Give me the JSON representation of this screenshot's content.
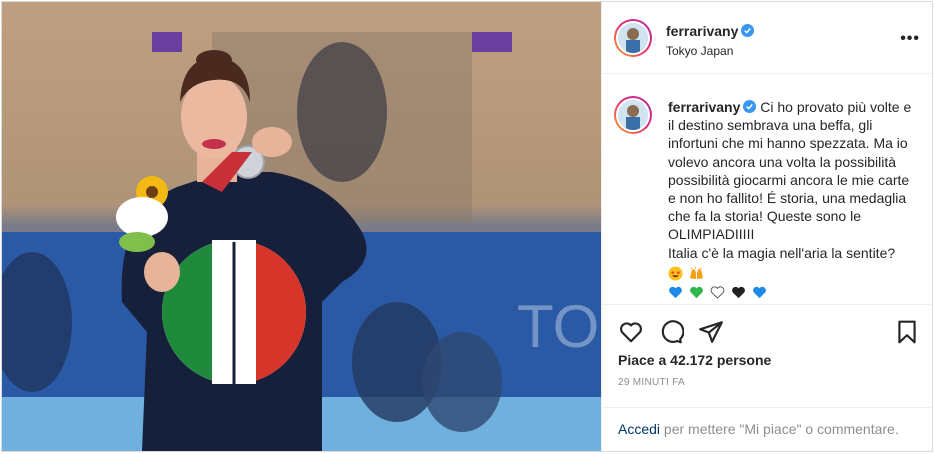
{
  "post": {
    "username": "ferrarivany",
    "location": "Tokyo Japan",
    "more_label": "•••",
    "caption_lines": [
      "Ci ho provato più volte e",
      "il destino sembrava una beffa, gli",
      "infortuni che mi hanno spezzata. Ma io",
      "volevo ancora una volta la possibilità",
      "possibilità giocarmi ancora le mie carte",
      "e non ho fallito! É storia, una medaglia",
      "che fa la storia! Queste sono le",
      "OLIMPIADIIIII",
      "Italia c'è la magia nell'aria la sentite?"
    ],
    "emojis_row1": [
      "star-struck-face",
      "raising-hands"
    ],
    "emojis_row2": [
      "blue-heart",
      "green-heart",
      "white-heart",
      "black-heart",
      "blue-heart"
    ],
    "likes": "Piace a 42.172 persone",
    "time": "29 MINUTI FA"
  },
  "login": {
    "link": "Accedi",
    "text": " per mettere \"Mi piace\" o commentare."
  },
  "colors": {
    "link": "#00376b",
    "muted": "#8e8e8e",
    "verified": "#3897f0",
    "avatar_ring": [
      "#f9a72b",
      "#e8306a",
      "#b524b0"
    ]
  },
  "icons": [
    "heart-icon",
    "comment-icon",
    "share-icon",
    "bookmark-icon",
    "verified-badge-icon",
    "more-options-icon"
  ]
}
